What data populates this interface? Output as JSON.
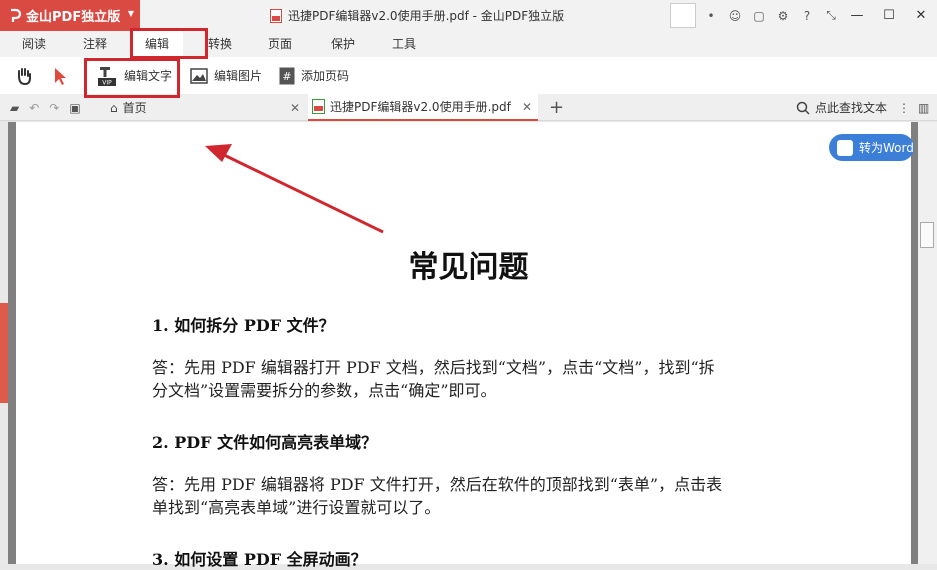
{
  "brand": {
    "name": "金山PDF独立版"
  },
  "window": {
    "title": "迅捷PDF编辑器v2.0使用手册.pdf - 金山PDF独立版"
  },
  "menu": {
    "items": [
      "阅读",
      "注释",
      "编辑",
      "转换",
      "页面",
      "保护",
      "工具"
    ],
    "active": "编辑"
  },
  "toolbar": {
    "edit_text": "编辑文字",
    "edit_image": "编辑图片",
    "add_page_number": "添加页码",
    "vip_badge": "VIP"
  },
  "tabs": {
    "home": "首页",
    "document": "迅捷PDF编辑器v2.0使用手册.pdf"
  },
  "search": {
    "label": "点此查找文本"
  },
  "convert": {
    "label": "转为Word"
  },
  "doc": {
    "title": "常见问题",
    "q1": "1. 如何拆分 PDF 文件？",
    "a1_line1": "答：先用 PDF 编辑器打开 PDF 文档，然后找到“文档”，点击“文档”，找到“拆",
    "a1_line2": "分文档”设置需要拆分的参数，点击“确定”即可。",
    "q2": "2. PDF 文件如何高亮表单域？",
    "a2_line1": "答：先用 PDF 编辑器将 PDF 文件打开，然后在软件的顶部找到“表单”，点击表",
    "a2_line2": "单找到“高亮表单域”进行设置就可以了。",
    "q3": "3. 如何设置 PDF 全屏动画？"
  },
  "colors": {
    "brand_red": "#d94a43",
    "annotation_red": "#d0262d",
    "word_blue": "#3b7fd9"
  }
}
